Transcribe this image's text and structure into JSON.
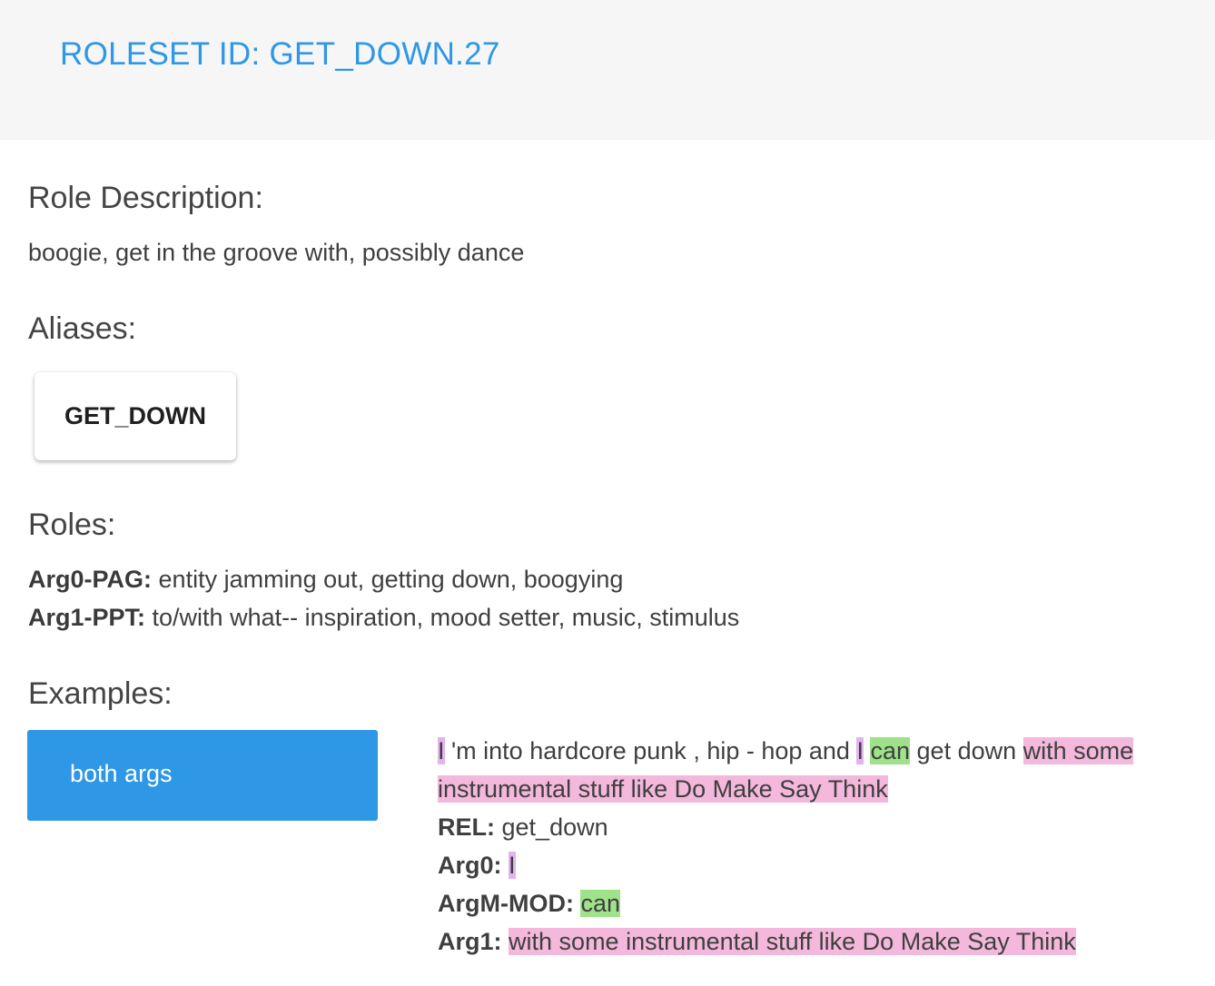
{
  "header": {
    "roleset_title": "ROLESET ID: GET_DOWN.27"
  },
  "role_description": {
    "heading": "Role Description:",
    "text": "boogie, get in the groove with, possibly dance"
  },
  "aliases": {
    "heading": "Aliases:",
    "items": [
      "GET_DOWN"
    ]
  },
  "roles": {
    "heading": "Roles:",
    "items": [
      {
        "label": "Arg0-PAG:",
        "description": "entity jamming out, getting down, boogying"
      },
      {
        "label": "Arg1-PPT:",
        "description": "to/with what-- inspiration, mood setter, music, stimulus"
      }
    ]
  },
  "examples": {
    "heading": "Examples:",
    "tabs": [
      {
        "label": "both args"
      }
    ],
    "sentence": {
      "t1": "I",
      "t2": " 'm into hardcore punk , hip - hop and ",
      "t3": "I",
      "t4": " ",
      "t5": "can",
      "t6": " get down ",
      "t7": "with some",
      "t8": "instrumental stuff like Do Make Say Think"
    },
    "args": [
      {
        "label": "REL:",
        "value": "get_down"
      },
      {
        "label": "Arg0:",
        "value": "I"
      },
      {
        "label": "ArgM-MOD:",
        "value": "can"
      },
      {
        "label": "Arg1:",
        "value": "with some instrumental stuff like Do Make Say Think"
      }
    ]
  },
  "colors": {
    "accent": "#2e97e6",
    "header_bg": "#f6f6f6",
    "arg0_highlight": "#e2b3ef",
    "argm_mod_highlight": "#9fe28a",
    "arg1_highlight": "#f3b8db"
  }
}
